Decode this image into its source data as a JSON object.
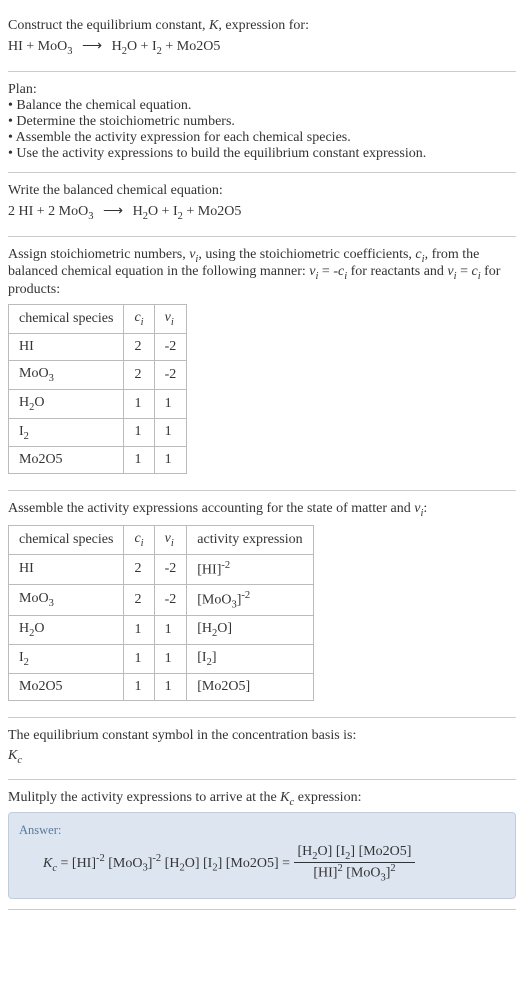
{
  "intro": {
    "line1": "Construct the equilibrium constant, K, expression for:",
    "eq": "HI + MoO₃ ⟶ H₂O + I₂ + Mo2O5"
  },
  "plan": {
    "heading": "Plan:",
    "b1": "• Balance the chemical equation.",
    "b2": "• Determine the stoichiometric numbers.",
    "b3": "• Assemble the activity expression for each chemical species.",
    "b4": "• Use the activity expressions to build the equilibrium constant expression."
  },
  "balanced": {
    "heading": "Write the balanced chemical equation:",
    "eq": "2 HI + 2 MoO₃ ⟶ H₂O + I₂ + Mo2O5"
  },
  "stoich": {
    "text": "Assign stoichiometric numbers, νᵢ, using the stoichiometric coefficients, cᵢ, from the balanced chemical equation in the following manner: νᵢ = -cᵢ for reactants and νᵢ = cᵢ for products:",
    "headers": {
      "species": "chemical species",
      "c": "cᵢ",
      "v": "νᵢ"
    },
    "rows": [
      {
        "species": "HI",
        "c": "2",
        "v": "-2"
      },
      {
        "species": "MoO₃",
        "c": "2",
        "v": "-2"
      },
      {
        "species": "H₂O",
        "c": "1",
        "v": "1"
      },
      {
        "species": "I₂",
        "c": "1",
        "v": "1"
      },
      {
        "species": "Mo2O5",
        "c": "1",
        "v": "1"
      }
    ]
  },
  "activity": {
    "text": "Assemble the activity expressions accounting for the state of matter and νᵢ:",
    "headers": {
      "species": "chemical species",
      "c": "cᵢ",
      "v": "νᵢ",
      "act": "activity expression"
    },
    "rows": [
      {
        "species": "HI",
        "c": "2",
        "v": "-2",
        "act": "[HI]⁻²"
      },
      {
        "species": "MoO₃",
        "c": "2",
        "v": "-2",
        "act": "[MoO₃]⁻²"
      },
      {
        "species": "H₂O",
        "c": "1",
        "v": "1",
        "act": "[H₂O]"
      },
      {
        "species": "I₂",
        "c": "1",
        "v": "1",
        "act": "[I₂]"
      },
      {
        "species": "Mo2O5",
        "c": "1",
        "v": "1",
        "act": "[Mo2O5]"
      }
    ]
  },
  "symbol": {
    "text": "The equilibrium constant symbol in the concentration basis is:",
    "sym": "K꜀"
  },
  "final": {
    "text": "Mulitply the activity expressions to arrive at the K꜀ expression:",
    "answer_label": "Answer:",
    "lhs": "K꜀ = [HI]⁻² [MoO₃]⁻² [H₂O] [I₂] [Mo2O5] = ",
    "num": "[H₂O] [I₂] [Mo2O5]",
    "den": "[HI]² [MoO₃]²"
  }
}
